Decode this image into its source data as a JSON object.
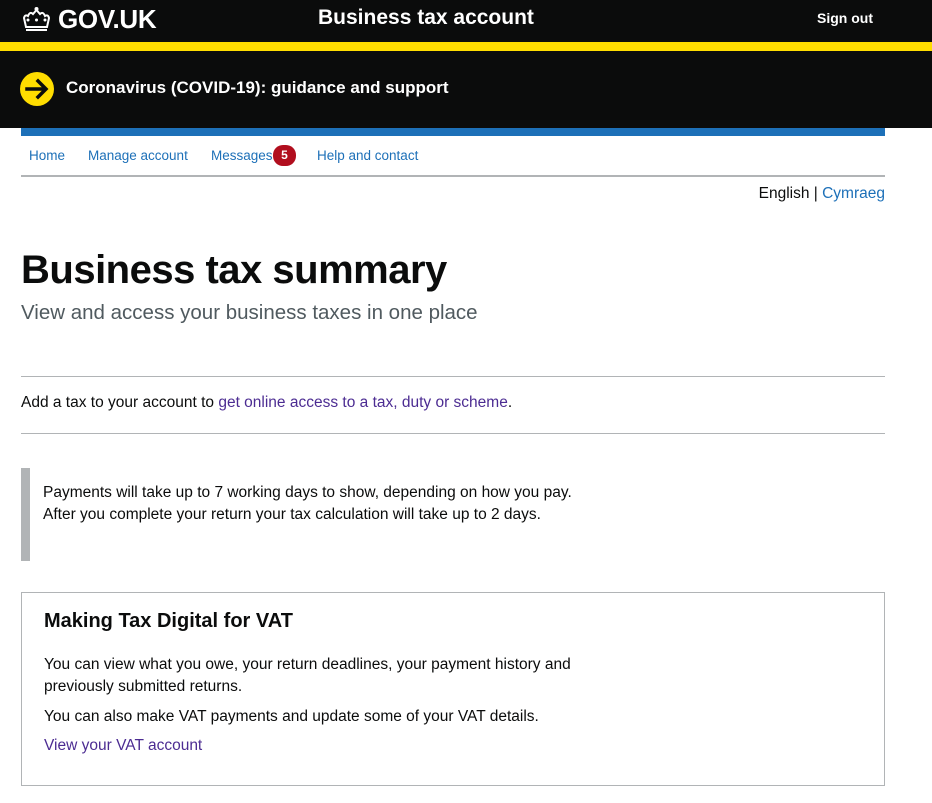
{
  "header": {
    "logo_text": "GOV.UK",
    "service_name": "Business tax account",
    "sign_out": "Sign out"
  },
  "banner": {
    "link_text": "Coronavirus (COVID-19): guidance and support"
  },
  "nav": {
    "home": "Home",
    "manage_account": "Manage account",
    "messages": "Messages",
    "messages_count": "5",
    "help": "Help and contact"
  },
  "language": {
    "current": "English",
    "separator": "|",
    "alternate": "Cymraeg"
  },
  "page": {
    "title": "Business tax summary",
    "caption": "View and access your business taxes in one place"
  },
  "add_tax": {
    "prefix": "Add a tax to your account to ",
    "link": "get online access to a tax, duty or scheme",
    "suffix": "."
  },
  "inset": {
    "text": "Payments will take up to 7 working days to show, depending on how you pay. After you complete your return your tax calculation will take up to 2 days."
  },
  "vat_card": {
    "heading": "Making Tax Digital for VAT",
    "para1": "You can view what you owe, your return deadlines, your payment history and previously submitted returns.",
    "para2": "You can also make VAT payments and update some of your VAT details.",
    "link": "View your VAT account"
  },
  "colors": {
    "header_bg": "#0b0c0c",
    "accent_yellow": "#ffdd00",
    "brand_blue": "#1d70b8",
    "badge_red": "#b10e1e",
    "visited_link": "#4c2c92"
  },
  "icons": {
    "logo": "crown-icon",
    "banner": "arrow-right-circle-icon"
  }
}
